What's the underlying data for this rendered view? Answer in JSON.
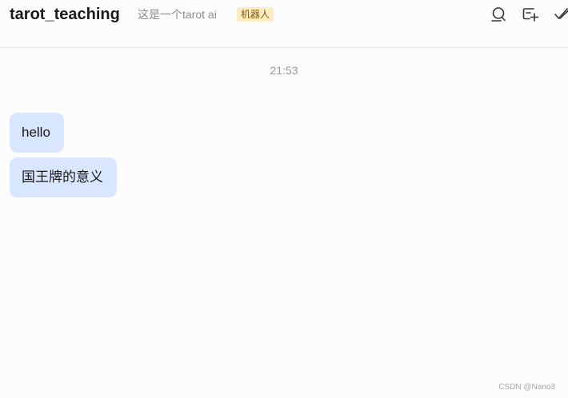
{
  "header": {
    "title": "tarot_teaching",
    "subtitle": "这是一个tarot ai",
    "badge": "机器人",
    "icons": [
      "search-icon",
      "add-chat-icon",
      "select-check-icon"
    ]
  },
  "chat": {
    "timestamp": "21:53",
    "messages": [
      {
        "text": "hello"
      },
      {
        "text": "国王牌的意义"
      }
    ]
  },
  "watermark": "CSDN @Nano3",
  "colors": {
    "bubble": "#d9e6ff",
    "badge_bg": "#fbecc4",
    "background": "#fcfcfc"
  }
}
